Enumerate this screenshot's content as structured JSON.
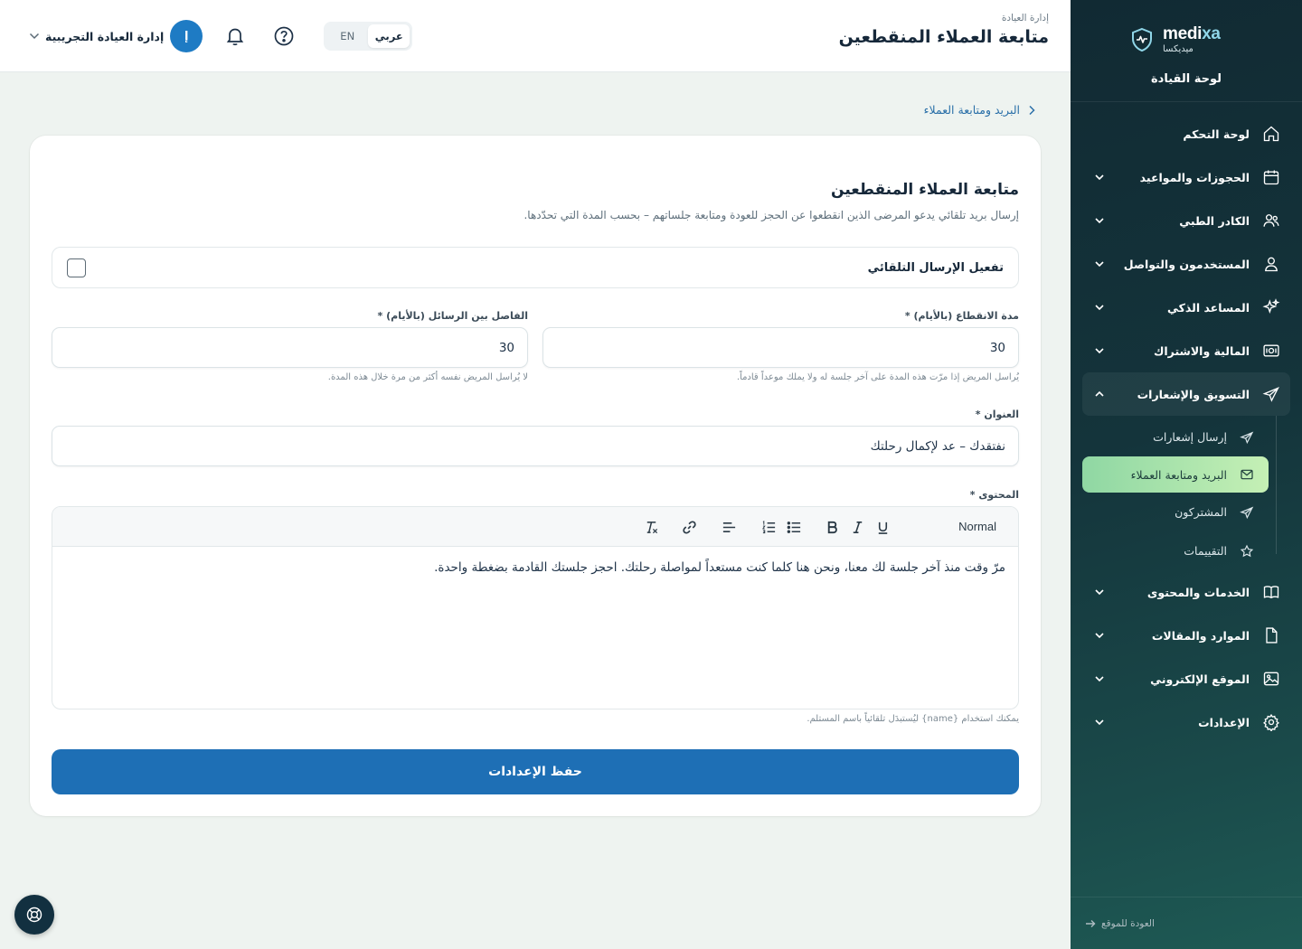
{
  "brand": {
    "name_en_prefix": "medi",
    "name_en_suffix": "xa",
    "name_ar": "ميديكسا",
    "panel_title": "لوحة القيادة"
  },
  "sidebar": {
    "items": [
      {
        "label": "لوحة التحكم",
        "icon": "home-icon"
      },
      {
        "label": "الحجوزات والمواعيد",
        "icon": "calendar-icon"
      },
      {
        "label": "الكادر الطبي",
        "icon": "users-icon"
      },
      {
        "label": "المستخدمون والتواصل",
        "icon": "user-icon"
      },
      {
        "label": "المساعد الذكي",
        "icon": "sparkles-icon"
      },
      {
        "label": "المالية والاشتراك",
        "icon": "money-icon"
      },
      {
        "label": "التسويق والإشعارات",
        "icon": "send-icon"
      },
      {
        "label": "الخدمات والمحتوى",
        "icon": "book-icon"
      },
      {
        "label": "الموارد والمقالات",
        "icon": "file-icon"
      },
      {
        "label": "الموقع الإلكتروني",
        "icon": "image-icon"
      },
      {
        "label": "الإعدادات",
        "icon": "gear-icon"
      }
    ],
    "sub_items": [
      {
        "label": "إرسال إشعارات",
        "icon": "send-icon"
      },
      {
        "label": "البريد ومتابعة العملاء",
        "icon": "mail-icon"
      },
      {
        "label": "المشتركون",
        "icon": "send-icon"
      },
      {
        "label": "التقييمات",
        "icon": "star-icon"
      }
    ],
    "back_label": "العودة للموقع"
  },
  "header": {
    "section": "إدارة العيادة",
    "title": "متابعة العملاء المنقطعين",
    "lang_ar": "عربي",
    "lang_en": "EN",
    "user_name": "إدارة العيادة التجريبية",
    "avatar_initial": "إ"
  },
  "breadcrumb": {
    "label": "البريد ومتابعة العملاء"
  },
  "card": {
    "title": "متابعة العملاء المنقطعين",
    "description": "إرسال بريد تلقائي يدعو المرضى الذين انقطعوا عن الحجز للعودة ومتابعة جلساتهم – بحسب المدة التي تحدّدها.",
    "toggle_label": "تفعيل الإرسال التلقائي",
    "toggle_checked": false,
    "inactivity": {
      "label": "مدة الانقطاع (بالأيام) *",
      "value": "30",
      "hint": "يُراسل المريض إذا مرّت هذه المدة على آخر جلسة له ولا يملك موعداً قادماً."
    },
    "interval": {
      "label": "الفاصل بين الرسائل (بالأيام) *",
      "value": "30",
      "hint": "لا يُراسل المريض نفسه أكثر من مرة خلال هذه المدة."
    },
    "subject": {
      "label": "العنوان *",
      "value": "نفتقدك – عد لإكمال رحلتك"
    },
    "content": {
      "label": "المحتوى *",
      "format": "Normal",
      "text": "مرّ وقت منذ آخر جلسة لك معنا، ونحن هنا كلما كنت مستعداً لمواصلة رحلتك. احجز جلستك القادمة بضغطة واحدة.",
      "hint": "يمكنك استخدام {name} ليُستبدَل تلقائياً باسم المستلم."
    },
    "save_label": "حفظ الإعدادات"
  },
  "colors": {
    "primary": "#1e6fb5",
    "sidebar": "#14343b",
    "active": "#b5e9b0",
    "page_bg": "#eef3f0"
  }
}
